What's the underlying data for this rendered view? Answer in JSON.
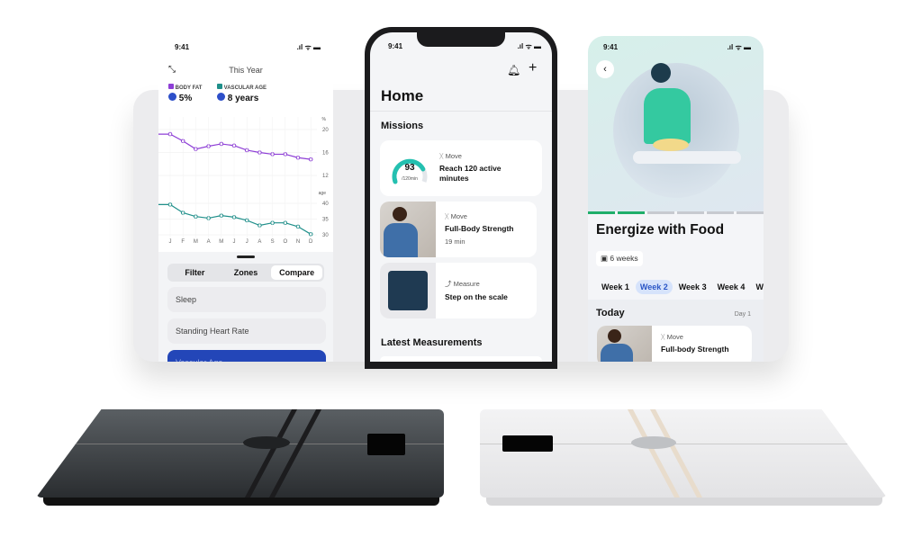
{
  "left_phone": {
    "time": "9:41",
    "period": "This Year",
    "legend": [
      {
        "label": "BODY FAT",
        "value": "5%",
        "color": "#8e3fd6"
      },
      {
        "label": "VASCULAR AGE",
        "value": "8 years",
        "color": "#1f8f8a"
      }
    ],
    "segments": [
      "Filter",
      "Zones",
      "Compare"
    ],
    "selected_segment": "Compare",
    "list": [
      "Sleep",
      "Standing Heart Rate",
      "Vascular Age"
    ]
  },
  "chart_data": [
    {
      "type": "line",
      "ylabel": "%",
      "ylim": [
        12,
        20
      ],
      "yticks": [
        "20",
        "16",
        "12"
      ],
      "categories": [
        "J",
        "F",
        "M",
        "A",
        "M",
        "J",
        "J",
        "A",
        "S",
        "O",
        "N",
        "D"
      ],
      "series": [
        {
          "name": "BODY FAT",
          "color": "#8e3fd6",
          "values": [
            19.2,
            18,
            16.6,
            17.1,
            17.5,
            17.2,
            16.4,
            16,
            15.7,
            15.7,
            15.1,
            14.8
          ]
        }
      ]
    },
    {
      "type": "line",
      "ylabel": "age",
      "ylim": [
        30,
        40
      ],
      "yticks": [
        "40",
        "35",
        "30"
      ],
      "categories": [
        "J",
        "F",
        "M",
        "A",
        "M",
        "J",
        "J",
        "A",
        "S",
        "O",
        "N",
        "D"
      ],
      "series": [
        {
          "name": "VASCULAR AGE",
          "color": "#1f8f8a",
          "values": [
            39.6,
            37,
            35.8,
            35.3,
            36.1,
            35.6,
            34.6,
            33,
            33.8,
            33.8,
            32.6,
            30.2
          ]
        }
      ]
    }
  ],
  "center_phone": {
    "time": "9:41",
    "title": "Home",
    "missions_label": "Missions",
    "missions": [
      {
        "category": "Move",
        "title": "Reach 120 active minutes",
        "gauge_value": "93",
        "gauge_unit": "/120min",
        "progress": 0.775
      },
      {
        "category": "Move",
        "title": "Full-Body Strength",
        "subtitle": "19 min"
      },
      {
        "category": "Measure",
        "title": "Step on the scale"
      }
    ],
    "latest_label": "Latest Measurements"
  },
  "right_phone": {
    "time": "9:41",
    "title": "Energize with Food",
    "duration": "6 weeks",
    "progress_segments_done": 2,
    "progress_segments_total": 6,
    "weeks": [
      "Week 1",
      "Week 2",
      "Week 3",
      "Week 4",
      "W"
    ],
    "selected_week": "Week 2",
    "today_label": "Today",
    "day_label": "Day 1",
    "activity": {
      "category": "Move",
      "title": "Full-body Strength"
    }
  }
}
